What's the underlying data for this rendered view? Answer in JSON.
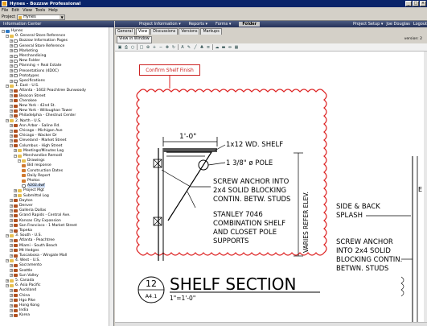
{
  "window": {
    "title": "Hynes - Bozzsw Professional",
    "controls": [
      "_",
      "□",
      "×"
    ]
  },
  "menu": [
    "File",
    "Edit",
    "View",
    "Tools",
    "Help"
  ],
  "project": {
    "label": "Project",
    "value": "Hynes"
  },
  "left_header": "Information Center",
  "right_header": {
    "items": [
      "Project Information ▾",
      "Reports ▾",
      "Forms ▾"
    ],
    "active": "Folder",
    "right_items": [
      "Project Setup ▾",
      "Joe Douglas",
      "Logout"
    ]
  },
  "tree": [
    {
      "l": 0,
      "t": "globe",
      "e": "-",
      "x": "Hynes"
    },
    {
      "l": 1,
      "t": "folder",
      "e": "-",
      "x": "0. General Store Reference"
    },
    {
      "l": 2,
      "t": "doc",
      "e": "+",
      "x": "Bozzsw Information Pages"
    },
    {
      "l": 2,
      "t": "doc",
      "e": "+",
      "x": "General Store Reference"
    },
    {
      "l": 2,
      "t": "doc",
      "e": "+",
      "x": "Marketing"
    },
    {
      "l": 2,
      "t": "doc",
      "e": "+",
      "x": "Merchandising"
    },
    {
      "l": 2,
      "t": "doc",
      "e": "+",
      "x": "New Folder"
    },
    {
      "l": 2,
      "t": "doc",
      "e": "+",
      "x": "Planning + Real Estate"
    },
    {
      "l": 2,
      "t": "doc",
      "e": "+",
      "x": "Presentations (4D0C)"
    },
    {
      "l": 2,
      "t": "doc",
      "e": "+",
      "x": "Prototypes"
    },
    {
      "l": 2,
      "t": "doc",
      "e": "+",
      "x": "Specifications"
    },
    {
      "l": 1,
      "t": "folder",
      "e": "-",
      "x": "1. East - U.S."
    },
    {
      "l": 2,
      "t": "store",
      "e": "+",
      "x": "Atlanta - 1602 Peachtree Dunwoody"
    },
    {
      "l": 2,
      "t": "store",
      "e": "+",
      "x": "Beacon Street"
    },
    {
      "l": 2,
      "t": "store",
      "e": "+",
      "x": "Cherokee"
    },
    {
      "l": 2,
      "t": "store",
      "e": "+",
      "x": "New York - 42nd St."
    },
    {
      "l": 2,
      "t": "store",
      "e": "+",
      "x": "New York - Willoughan Tower"
    },
    {
      "l": 2,
      "t": "store",
      "e": "+",
      "x": "Philadelphia - Chestnut Center"
    },
    {
      "l": 1,
      "t": "folder",
      "e": "-",
      "x": "2. North - U.S."
    },
    {
      "l": 2,
      "t": "store",
      "e": "+",
      "x": "Ann Arbor - Saline Rd."
    },
    {
      "l": 2,
      "t": "store",
      "e": "+",
      "x": "Chicago - Michigan Ave"
    },
    {
      "l": 2,
      "t": "store",
      "e": "+",
      "x": "Chicago - Wacker Dr"
    },
    {
      "l": 2,
      "t": "store",
      "e": "+",
      "x": "Cleveland - Market Street"
    },
    {
      "l": 2,
      "t": "store",
      "e": "-",
      "x": "Columbus - High Street"
    },
    {
      "l": 3,
      "t": "folder",
      "e": "+",
      "x": "Meetings/Minutes Log"
    },
    {
      "l": 3,
      "t": "folder",
      "e": "-",
      "x": "Merchandise Remodl"
    },
    {
      "l": 4,
      "t": "folder",
      "e": "-",
      "x": "Drawings"
    },
    {
      "l": 5,
      "t": "group",
      "e": "",
      "x": "Bid response"
    },
    {
      "l": 5,
      "t": "group",
      "e": "",
      "x": "Construction Dates"
    },
    {
      "l": 5,
      "t": "group",
      "e": "",
      "x": "Daily Report"
    },
    {
      "l": 5,
      "t": "group",
      "e": "",
      "x": "Photos"
    },
    {
      "l": 5,
      "t": "doc",
      "e": "",
      "x": "A202.dwf",
      "sel": true
    },
    {
      "l": 3,
      "t": "folder",
      "e": "+",
      "x": "Project Mgt"
    },
    {
      "l": 3,
      "t": "folder",
      "e": "+",
      "x": "Submittal Log"
    },
    {
      "l": 2,
      "t": "store",
      "e": "+",
      "x": "Dayton"
    },
    {
      "l": 2,
      "t": "store",
      "e": "+",
      "x": "Denver"
    },
    {
      "l": 2,
      "t": "store",
      "e": "+",
      "x": "Galleria Dallas"
    },
    {
      "l": 2,
      "t": "store",
      "e": "+",
      "x": "Grand Rapids - Central Ave."
    },
    {
      "l": 2,
      "t": "store",
      "e": "+",
      "x": "Kansas City Expansion"
    },
    {
      "l": 2,
      "t": "store",
      "e": "+",
      "x": "San Francisco - 1 Market Street"
    },
    {
      "l": 2,
      "t": "store",
      "e": "+",
      "x": "Topeka"
    },
    {
      "l": 1,
      "t": "folder",
      "e": "-",
      "x": "3. South - U.S."
    },
    {
      "l": 2,
      "t": "store",
      "e": "+",
      "x": "Atlanta - Peachtree"
    },
    {
      "l": 2,
      "t": "store",
      "e": "+",
      "x": "Miami - South Beach"
    },
    {
      "l": 2,
      "t": "store",
      "e": "+",
      "x": "Mt Hedges"
    },
    {
      "l": 2,
      "t": "store",
      "e": "+",
      "x": "Tuscaloosa - Wingate Mall"
    },
    {
      "l": 1,
      "t": "folder",
      "e": "-",
      "x": "4. West - U.S."
    },
    {
      "l": 2,
      "t": "store",
      "e": "+",
      "x": "Sacramento"
    },
    {
      "l": 2,
      "t": "store",
      "e": "+",
      "x": "Seattle"
    },
    {
      "l": 2,
      "t": "store",
      "e": "+",
      "x": "Sun Valley"
    },
    {
      "l": 1,
      "t": "folder",
      "e": "+",
      "x": "5. Canada"
    },
    {
      "l": 1,
      "t": "folder",
      "e": "-",
      "x": "6. Asia Pacific"
    },
    {
      "l": 2,
      "t": "store",
      "e": "+",
      "x": "Auckland"
    },
    {
      "l": 2,
      "t": "store",
      "e": "+",
      "x": "China"
    },
    {
      "l": 2,
      "t": "store",
      "e": "+",
      "x": "Hgo Pike"
    },
    {
      "l": 2,
      "t": "store",
      "e": "+",
      "x": "Hong Kong"
    },
    {
      "l": 2,
      "t": "store",
      "e": "+",
      "x": "India"
    },
    {
      "l": 2,
      "t": "store",
      "e": "+",
      "x": "Korea"
    }
  ],
  "tabs": [
    "General",
    "View",
    "Discussions",
    "Versions",
    "Markups"
  ],
  "active_tab": "View",
  "view_in_window": "View in Window",
  "version": "version: 2",
  "markup_callout": "Confirm Shelf Finish",
  "drawing": {
    "dim": "1'-0\"",
    "n1": "1x12 WD. SHELF",
    "n2": "1 3/8\" ø POLE",
    "n3": [
      "SCREW ANCHOR INTO",
      "2x4 SOLID BLOCKING",
      "CONTIN. BETW. STUDS"
    ],
    "n4": [
      "STANLEY 7046",
      "COMBINATION SHELF",
      "AND CLOSET POLE",
      "SUPPORTS"
    ],
    "vert": "VARIES REFER ELEV.",
    "r1": [
      "SIDE & BACK",
      "SPLASH"
    ],
    "r2": [
      "SCREW ANCHOR",
      "INTO 2x4 SOLID",
      "BLOCKING CONTIN.",
      "BETWN. STUDS"
    ],
    "detail_num": "12",
    "sheet": "A4.1",
    "title": "SHELF SECTION",
    "scale": "1\"=1'-0\"",
    "edge_letter": "E"
  }
}
